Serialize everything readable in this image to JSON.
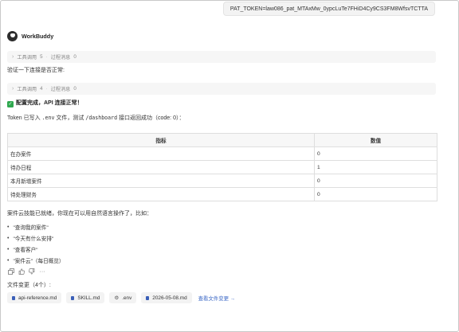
{
  "token_message": "PAT_TOKEN=law086_pat_MTAxMw_0ypcLuTe7FHiD4Cy9CS3FM8WfsvTCTTA",
  "app": {
    "name": "WorkBuddy"
  },
  "tool_rows": [
    {
      "tool_label": "工具调用",
      "tool_count": "5",
      "sep": "·",
      "process_label": "过程消息",
      "process_count": "0"
    },
    {
      "tool_label": "工具调用",
      "tool_count": "4",
      "sep": "·",
      "process_label": "过程消息",
      "process_count": "0"
    }
  ],
  "user_prompt": "验证一下连接是否正常:",
  "status": {
    "icon": "check-icon",
    "text": "配置完成，API 连接正常！"
  },
  "token_line": {
    "pre": "Token 已写入 ",
    "env": ".env",
    "mid": " 文件，测试 ",
    "path": "/dashboard",
    "post": " 接口返回成功（code: 0）："
  },
  "table": {
    "headers": [
      "指标",
      "数值"
    ],
    "rows": [
      [
        "在办案件",
        "0"
      ],
      [
        "待办日程",
        "1"
      ],
      [
        "本月新增案件",
        "0"
      ],
      [
        "待处理财务",
        "0"
      ]
    ]
  },
  "summary": "案件云技能已就绪，你现在可以用自然语言操作了，比如：",
  "examples": [
    "\"查询我的案件\"",
    "\"今天有什么安排\"",
    "\"查看客户\"",
    "\"案件云\"（每日概览）"
  ],
  "action_icons": [
    "copy-icon",
    "thumbs-up-icon",
    "thumbs-down-icon",
    "more-icon"
  ],
  "file_changes_label": "文件变更（4个）:",
  "files": [
    {
      "name": "api-reference.md",
      "icon": "file-icon"
    },
    {
      "name": "SKILL.md",
      "icon": "file-icon"
    },
    {
      "name": ".env",
      "icon": "gear-icon"
    },
    {
      "name": "2026-05-08.md",
      "icon": "file-icon"
    }
  ],
  "view_changes_link": "查看文件变更 →",
  "colors": {
    "accent_link": "#3b68c6",
    "success": "#2fa84f",
    "file_icon": "#3a5fb8"
  }
}
